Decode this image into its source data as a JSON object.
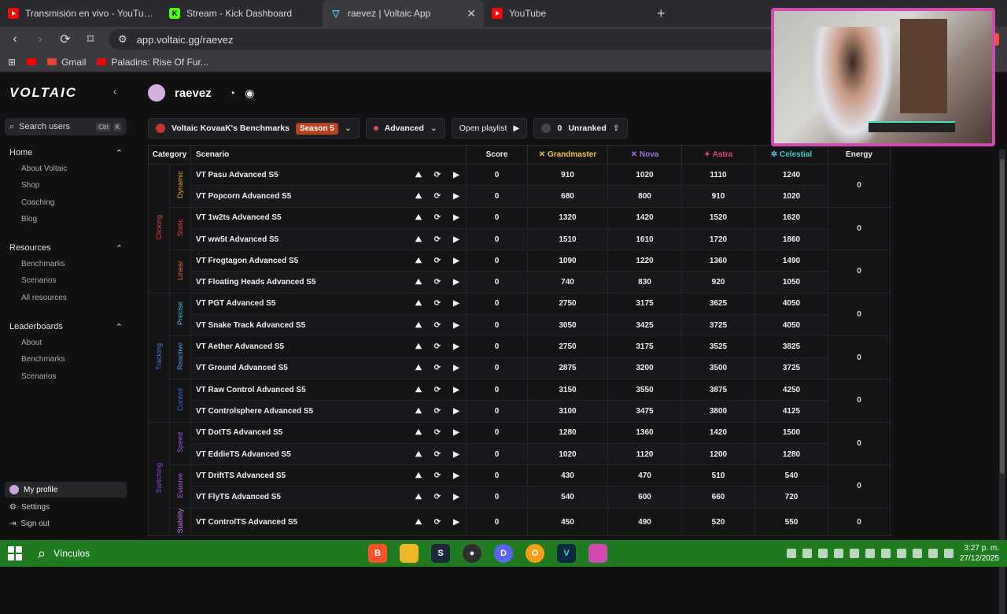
{
  "browser": {
    "tabs": [
      {
        "title": "Transmisión en vivo - YouTube Studio",
        "icon": "youtube-icon",
        "active": false
      },
      {
        "title": "Stream - Kick Dashboard",
        "icon": "kick-icon",
        "active": false
      },
      {
        "title": "raevez | Voltaic App",
        "icon": "voltaic-icon",
        "active": true
      },
      {
        "title": "YouTube",
        "icon": "youtube-icon",
        "active": false
      }
    ],
    "url": "app.voltaic.gg/raevez",
    "bookmarks": [
      {
        "label": "Gmail"
      },
      {
        "label": "Paladins: Rise Of Fur..."
      }
    ]
  },
  "sidebar": {
    "logo": "VOLTAIC",
    "search_label": "Search users",
    "search_kbd": [
      "Ctrl",
      "K"
    ],
    "sections": [
      {
        "title": "Home",
        "items": [
          "About Voltaic",
          "Shop",
          "Coaching",
          "Blog"
        ]
      },
      {
        "title": "Resources",
        "items": [
          "Benchmarks",
          "Scenarios",
          "All resources"
        ]
      },
      {
        "title": "Leaderboards",
        "items": [
          "About",
          "Benchmarks",
          "Scenarios"
        ]
      }
    ],
    "bottom": {
      "profile": "My profile",
      "settings": "Settings",
      "signout": "Sign out"
    }
  },
  "main": {
    "username": "raevez",
    "benchmark": "Voltaic KovaaK's Benchmarks",
    "season": "Season 5",
    "difficulty": "Advanced",
    "playlist": "Open playlist",
    "rank_value": "0",
    "rank_label": "Unranked"
  },
  "table": {
    "headers": {
      "category": "Category",
      "scenario": "Scenario",
      "score": "Score",
      "grandmaster": "Grandmaster",
      "nova": "Nova",
      "astra": "Astra",
      "celestial": "Celestial",
      "energy": "Energy"
    },
    "categories": [
      {
        "name": "Clicking",
        "class": "cat-click",
        "rows": 6
      },
      {
        "name": "Tracking",
        "class": "cat-track",
        "rows": 6
      },
      {
        "name": "Switching",
        "class": "cat-switch",
        "rows": 5
      }
    ],
    "subcategories": [
      {
        "name": "Dynamic",
        "class": "sub-dyn",
        "rows": 2,
        "energy": "0"
      },
      {
        "name": "Static",
        "class": "sub-static",
        "rows": 2,
        "energy": "0"
      },
      {
        "name": "Linear",
        "class": "sub-linear",
        "rows": 2,
        "energy": "0"
      },
      {
        "name": "Precise",
        "class": "sub-precise",
        "rows": 2,
        "energy": "0"
      },
      {
        "name": "Reactive",
        "class": "sub-reactive",
        "rows": 2,
        "energy": "0"
      },
      {
        "name": "Control",
        "class": "sub-control",
        "rows": 2,
        "energy": "0"
      },
      {
        "name": "Speed",
        "class": "sub-speed",
        "rows": 2,
        "energy": "0"
      },
      {
        "name": "Evasive",
        "class": "sub-evasive",
        "rows": 2,
        "energy": "0"
      },
      {
        "name": "Stability",
        "class": "sub-stab",
        "rows": 1,
        "energy": "0"
      }
    ],
    "rows": [
      {
        "scenario": "VT Pasu Advanced S5",
        "score": "0",
        "gm": "910",
        "nova": "1020",
        "astra": "1110",
        "cel": "1240"
      },
      {
        "scenario": "VT Popcorn Advanced S5",
        "score": "0",
        "gm": "680",
        "nova": "800",
        "astra": "910",
        "cel": "1020"
      },
      {
        "scenario": "VT 1w2ts Advanced S5",
        "score": "0",
        "gm": "1320",
        "nova": "1420",
        "astra": "1520",
        "cel": "1620"
      },
      {
        "scenario": "VT ww5t Advanced S5",
        "score": "0",
        "gm": "1510",
        "nova": "1610",
        "astra": "1720",
        "cel": "1860"
      },
      {
        "scenario": "VT Frogtagon Advanced S5",
        "score": "0",
        "gm": "1090",
        "nova": "1220",
        "astra": "1360",
        "cel": "1490"
      },
      {
        "scenario": "VT Floating Heads Advanced S5",
        "score": "0",
        "gm": "740",
        "nova": "830",
        "astra": "920",
        "cel": "1050"
      },
      {
        "scenario": "VT PGT Advanced S5",
        "score": "0",
        "gm": "2750",
        "nova": "3175",
        "astra": "3625",
        "cel": "4050"
      },
      {
        "scenario": "VT Snake Track Advanced S5",
        "score": "0",
        "gm": "3050",
        "nova": "3425",
        "astra": "3725",
        "cel": "4050"
      },
      {
        "scenario": "VT Aether Advanced S5",
        "score": "0",
        "gm": "2750",
        "nova": "3175",
        "astra": "3525",
        "cel": "3825"
      },
      {
        "scenario": "VT Ground Advanced S5",
        "score": "0",
        "gm": "2875",
        "nova": "3200",
        "astra": "3500",
        "cel": "3725"
      },
      {
        "scenario": "VT Raw Control Advanced S5",
        "score": "0",
        "gm": "3150",
        "nova": "3550",
        "astra": "3875",
        "cel": "4250"
      },
      {
        "scenario": "VT Controlsphere Advanced S5",
        "score": "0",
        "gm": "3100",
        "nova": "3475",
        "astra": "3800",
        "cel": "4125"
      },
      {
        "scenario": "VT DotTS Advanced S5",
        "score": "0",
        "gm": "1280",
        "nova": "1360",
        "astra": "1420",
        "cel": "1500"
      },
      {
        "scenario": "VT EddieTS Advanced S5",
        "score": "0",
        "gm": "1020",
        "nova": "1120",
        "astra": "1200",
        "cel": "1280"
      },
      {
        "scenario": "VT DriftTS Advanced S5",
        "score": "0",
        "gm": "430",
        "nova": "470",
        "astra": "510",
        "cel": "540"
      },
      {
        "scenario": "VT FlyTS Advanced S5",
        "score": "0",
        "gm": "540",
        "nova": "600",
        "astra": "660",
        "cel": "720"
      },
      {
        "scenario": "VT ControlTS Advanced S5",
        "score": "0",
        "gm": "450",
        "nova": "490",
        "astra": "520",
        "cel": "550"
      }
    ]
  },
  "taskbar": {
    "search": "Vínculos",
    "time": "3:27 p. m.",
    "date": "27/12/2025"
  }
}
